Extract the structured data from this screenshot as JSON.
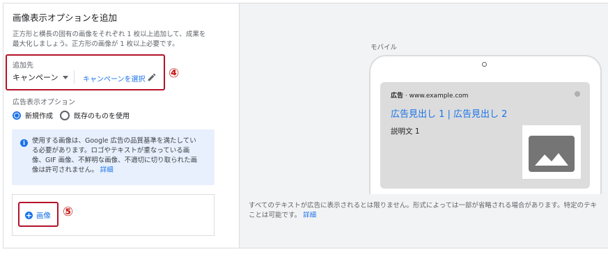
{
  "left": {
    "title": "画像表示オプションを追加",
    "description_lines": [
      "正方形と横長の固有の画像をそれぞれ 1 枚以上追加して、成果を",
      "最大化しましょう。正方形の画像が 1 枚以上必要です。"
    ],
    "add_to_label": "追加先",
    "campaign_dropdown": "キャンペーン",
    "select_campaign_link": "キャンペーンを選択",
    "badge_4": "④",
    "options_label": "広告表示オプション",
    "radio_new": "新規作成",
    "radio_existing": "既存のものを使用",
    "info_lines": [
      "使用する画像は、Google 広告の品質基準を満たしてい",
      "る必要があります。ロゴやテキストが重なっている画",
      "像、GIF 画像、不鮮明な画像、不適切に切り取られた画"
    ],
    "info_last_line": "像は許可されません。",
    "info_link": "詳細",
    "add_image_button": "画像",
    "badge_5": "⑤"
  },
  "preview": {
    "mobile_label": "モバイル",
    "ad_label": "広告",
    "ad_url": "· www.example.com",
    "ad_headline": "広告見出し 1 | 広告見出し 2",
    "ad_description": "説明文 1",
    "note_line1": "すべてのテキストが広告に表示されるとは限りません。形式によっては一部が省略される場合があります。特定のテキ",
    "note_line2": "ことは可能です。",
    "note_link": "詳細"
  },
  "colors": {
    "accent": "#1a73e8",
    "highlight_border": "#b3122a",
    "badge": "#c5221f",
    "info_bg": "#e8f0fe",
    "preview_bg": "#f1f3f4"
  },
  "icons": [
    "pencil-icon",
    "info-icon",
    "add-circle-icon",
    "image-placeholder-icon"
  ]
}
